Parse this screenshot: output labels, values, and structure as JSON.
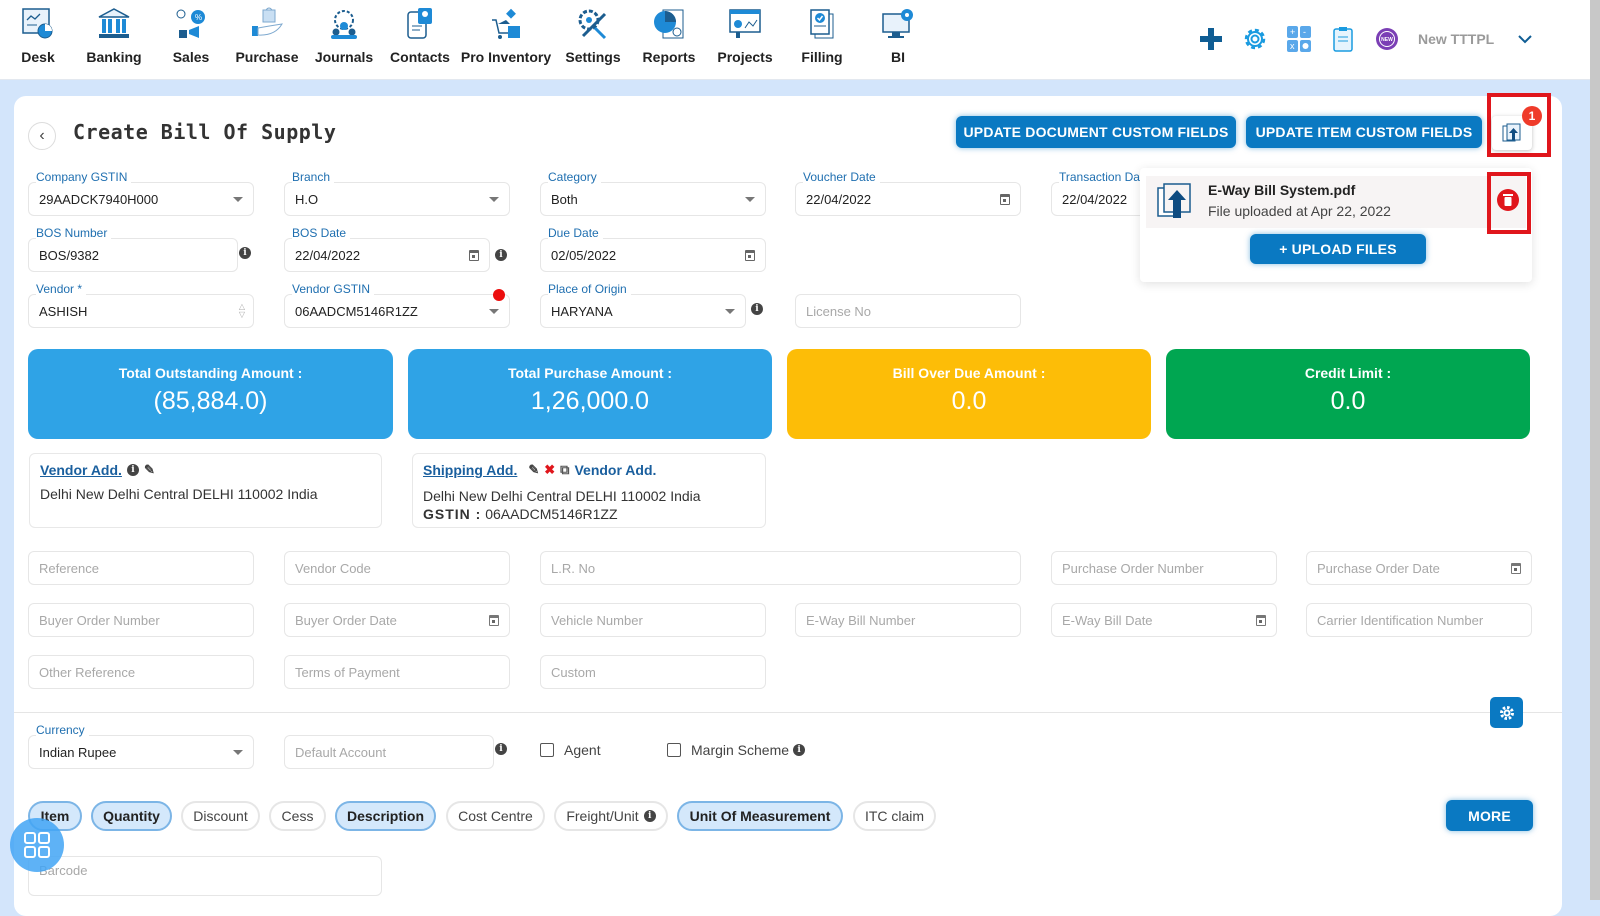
{
  "nav": {
    "items": [
      {
        "label": "Desk",
        "icon": "desk-icon"
      },
      {
        "label": "Banking",
        "icon": "bank-icon"
      },
      {
        "label": "Sales",
        "icon": "sales-icon"
      },
      {
        "label": "Purchase",
        "icon": "purchase-icon"
      },
      {
        "label": "Journals",
        "icon": "journals-icon"
      },
      {
        "label": "Contacts",
        "icon": "contacts-icon"
      },
      {
        "label": "Pro Inventory",
        "icon": "inventory-icon"
      },
      {
        "label": "Settings",
        "icon": "settings-icon"
      },
      {
        "label": "Reports",
        "icon": "reports-icon"
      },
      {
        "label": "Projects",
        "icon": "projects-icon"
      },
      {
        "label": "Filling",
        "icon": "filling-icon"
      },
      {
        "label": "BI",
        "icon": "bi-icon"
      }
    ],
    "org_name": "New TTTPL",
    "new_badge": "NEW"
  },
  "header": {
    "title": "Create Bill Of Supply",
    "update_document_btn": "UPDATE DOCUMENT CUSTOM FIELDS",
    "update_item_btn": "UPDATE ITEM CUSTOM FIELDS",
    "attachment_count": "1"
  },
  "attachments": {
    "file_name": "E-Way Bill System.pdf",
    "uploaded_text": "File uploaded at Apr 22, 2022",
    "upload_btn": "+ UPLOAD FILES"
  },
  "form": {
    "company_gstin": {
      "label": "Company GSTIN",
      "value": "29AADCK7940H000"
    },
    "branch": {
      "label": "Branch",
      "value": "H.O"
    },
    "category": {
      "label": "Category",
      "value": "Both"
    },
    "voucher_date": {
      "label": "Voucher Date",
      "value": "22/04/2022"
    },
    "transaction_date": {
      "label": "Transaction Da",
      "value": "22/04/2022"
    },
    "bos_number": {
      "label": "BOS Number",
      "value": "BOS/9382"
    },
    "bos_date": {
      "label": "BOS Date",
      "value": "22/04/2022"
    },
    "due_date": {
      "label": "Due Date",
      "value": "02/05/2022"
    },
    "vendor": {
      "label": "Vendor *",
      "value": "ASHISH"
    },
    "vendor_gstin": {
      "label": "Vendor GSTIN",
      "value": "06AADCM5146R1ZZ"
    },
    "place_of_origin": {
      "label": "Place of Origin",
      "value": "HARYANA"
    },
    "license_no": {
      "placeholder": "License No"
    }
  },
  "stats": [
    {
      "title": "Total Outstanding Amount :",
      "value": "(85,884.0)",
      "color": "#2fa3e6"
    },
    {
      "title": "Total Purchase Amount :",
      "value": "1,26,000.0",
      "color": "#2fa3e6"
    },
    {
      "title": "Bill Over Due Amount :",
      "value": "0.0",
      "color": "#fdbd07"
    },
    {
      "title": "Credit Limit :",
      "value": "0.0",
      "color": "#00a651"
    }
  ],
  "vendor_address": {
    "title": "Vendor Add.",
    "text": "Delhi New Delhi Central DELHI 110002 India"
  },
  "shipping_address": {
    "title": "Shipping Add.",
    "copy_label": "Vendor Add.",
    "text": "Delhi New Delhi Central DELHI 110002 India",
    "gstin_label": "GSTIN :",
    "gstin_value": "06AADCM5146R1ZZ"
  },
  "extra_fields": {
    "reference": "Reference",
    "vendor_code": "Vendor Code",
    "lr_no": "L.R. No",
    "purchase_order_number": "Purchase Order Number",
    "purchase_order_date": "Purchase Order Date",
    "buyer_order_number": "Buyer Order Number",
    "buyer_order_date": "Buyer Order Date",
    "vehicle_number": "Vehicle Number",
    "eway_bill_number": "E-Way Bill Number",
    "eway_bill_date": "E-Way Bill Date",
    "carrier_id_number": "Carrier Identification Number",
    "other_reference": "Other Reference",
    "terms_of_payment": "Terms of Payment",
    "custom": "Custom"
  },
  "currency": {
    "label": "Currency",
    "value": "Indian Rupee"
  },
  "default_account": {
    "placeholder": "Default Account"
  },
  "agent_label": "Agent",
  "margin_scheme_label": "Margin Scheme",
  "columns": [
    {
      "label": "Item",
      "active": true
    },
    {
      "label": "Quantity",
      "active": true
    },
    {
      "label": "Discount",
      "active": false
    },
    {
      "label": "Cess",
      "active": false
    },
    {
      "label": "Description",
      "active": true
    },
    {
      "label": "Cost Centre",
      "active": false
    },
    {
      "label": "Freight/Unit",
      "active": false
    },
    {
      "label": "Unit Of Measurement",
      "active": true
    },
    {
      "label": "ITC claim",
      "active": false
    }
  ],
  "more_btn": "MORE",
  "barcode": {
    "placeholder": "Barcode"
  }
}
